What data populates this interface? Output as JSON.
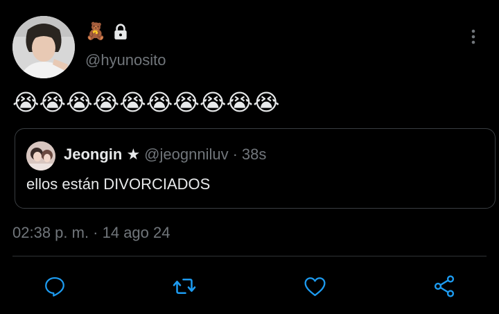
{
  "author": {
    "name_emoji": "🧸",
    "handle": "@hyunosito",
    "avatar_icon": "avatar-photo",
    "protected_icon": "lock-icon"
  },
  "tweet": {
    "text": "😭😭😭😭😭😭😭😭😭😭"
  },
  "quoted_tweet": {
    "name": "Jeongin ★",
    "handle": "@jeognniluv",
    "separator": "·",
    "time": "38s",
    "text": "ellos están DIVORCIADOS"
  },
  "timestamp": "02:38 p. m. · 14 ago 24",
  "actions": {
    "reply_icon": "reply-icon",
    "retweet_icon": "retweet-icon",
    "like_icon": "heart-icon",
    "share_icon": "share-icon"
  },
  "colors": {
    "background": "#000000",
    "text_primary": "#e7e9ea",
    "text_secondary": "#71767b",
    "border": "#3a3e42",
    "icon": "#1d9bf0"
  }
}
